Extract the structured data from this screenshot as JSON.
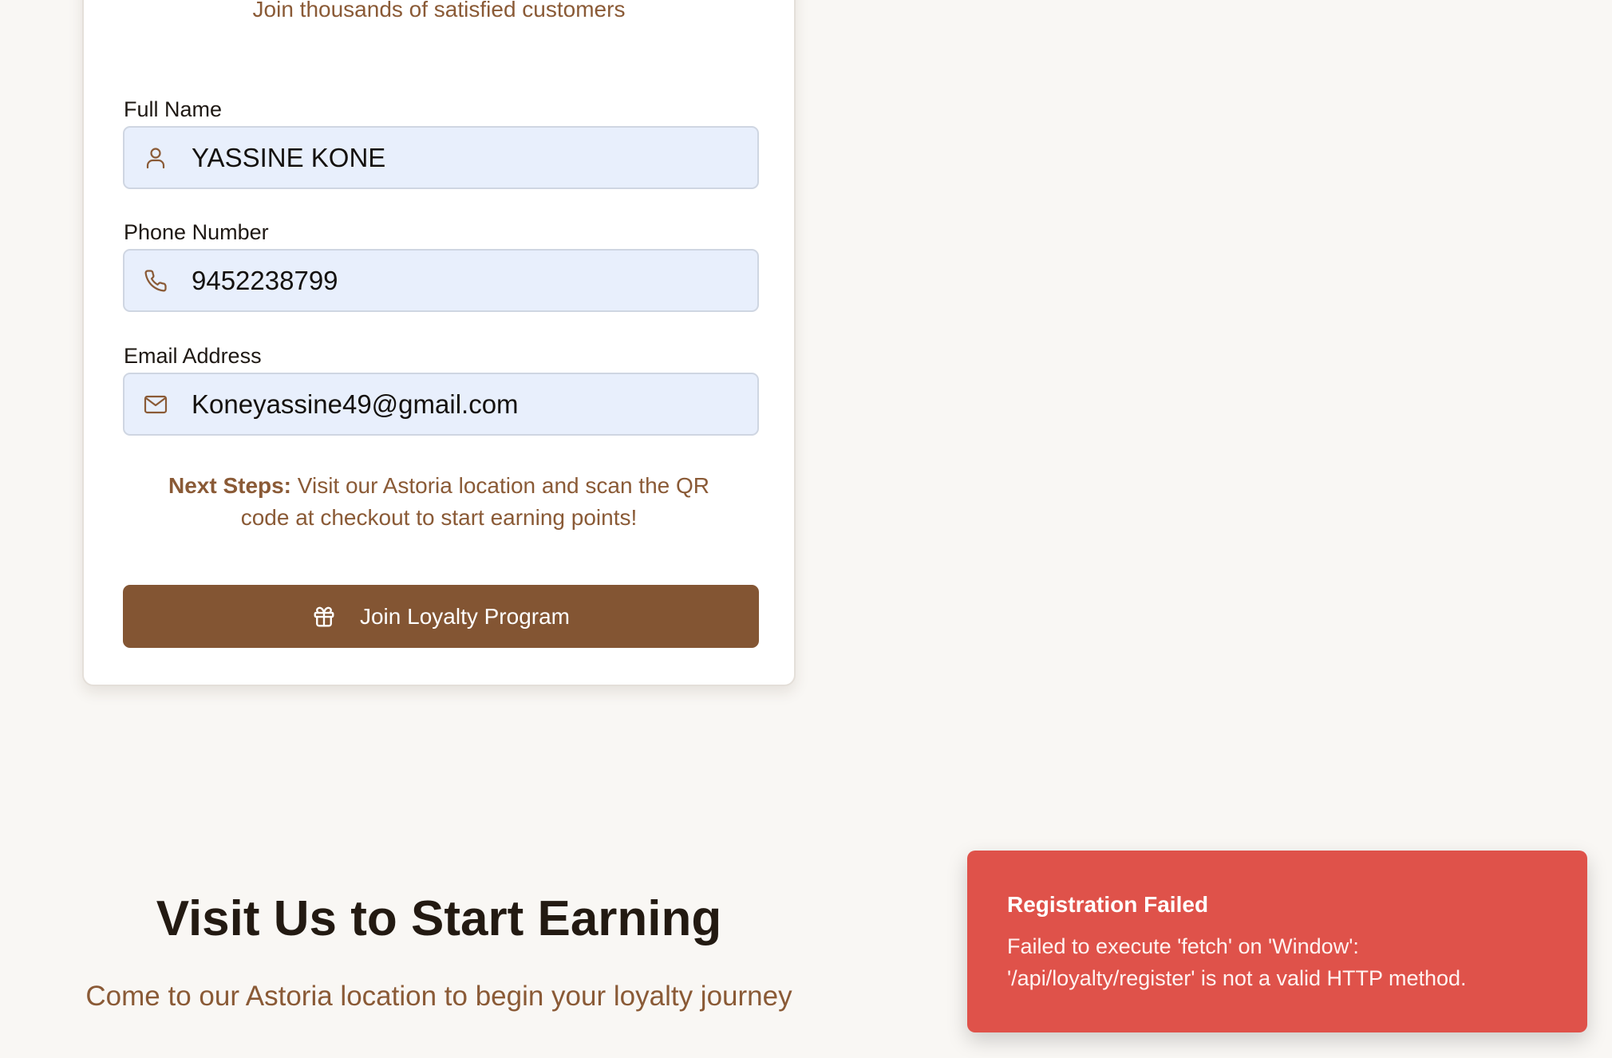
{
  "card": {
    "subtitle": "Join thousands of satisfied customers",
    "fields": {
      "full_name": {
        "label": "Full Name",
        "value": "YASSINE KONE",
        "icon": "user-icon"
      },
      "phone": {
        "label": "Phone Number",
        "value": "9452238799",
        "icon": "phone-icon"
      },
      "email": {
        "label": "Email Address",
        "value": "Koneyassine49@gmail.com",
        "icon": "mail-icon"
      }
    },
    "next_steps": {
      "prefix": "Next Steps:",
      "text": "Visit our Astoria location and scan the QR code at checkout to start earning points!"
    },
    "join_button": {
      "label": "Join Loyalty Program",
      "icon": "gift-icon"
    }
  },
  "visit": {
    "title": "Visit Us to Start Earning",
    "subtitle": "Come to our Astoria location to begin your loyalty journey"
  },
  "toast": {
    "title": "Registration Failed",
    "message": "Failed to execute 'fetch' on 'Window': '/api/loyalty/register' is not a valid HTTP method."
  },
  "colors": {
    "brand": "#835533",
    "text_accent": "#8a5a36",
    "field_bg": "#e8effc",
    "toast_bg": "#df524a",
    "page_bg": "#f9f7f4"
  }
}
